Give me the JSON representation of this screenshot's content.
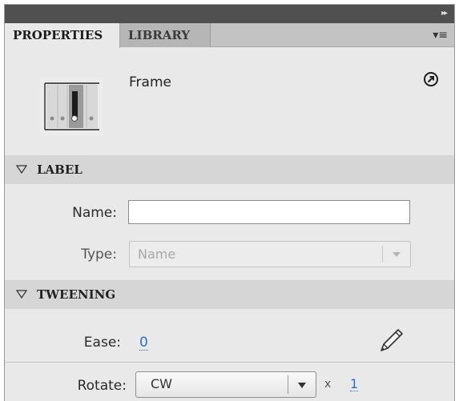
{
  "tabs": [
    {
      "label": "PROPERTIES",
      "active": true
    },
    {
      "label": "LIBRARY",
      "active": false
    }
  ],
  "header": {
    "collapse_glyph": "▸▸",
    "menu_glyph": "▾≡",
    "object_type": "Frame",
    "thumbnail_icon": "frame-icon",
    "help_icon": "arrow-circle-icon"
  },
  "sections": {
    "label": {
      "title": "LABEL",
      "name_label": "Name:",
      "name_value": "",
      "type_label": "Type:",
      "type_value": "Name"
    },
    "tweening": {
      "title": "TWEENING",
      "ease_label": "Ease:",
      "ease_value": "0",
      "rotate_label": "Rotate:",
      "rotate_value": "CW",
      "times_symbol": "x",
      "rotate_count": "1"
    }
  },
  "colors": {
    "titlebar": "#505050",
    "panel_bg": "#e9e9e9",
    "section_bg": "#d6d6d6",
    "link_blue": "#2d6fc4"
  }
}
